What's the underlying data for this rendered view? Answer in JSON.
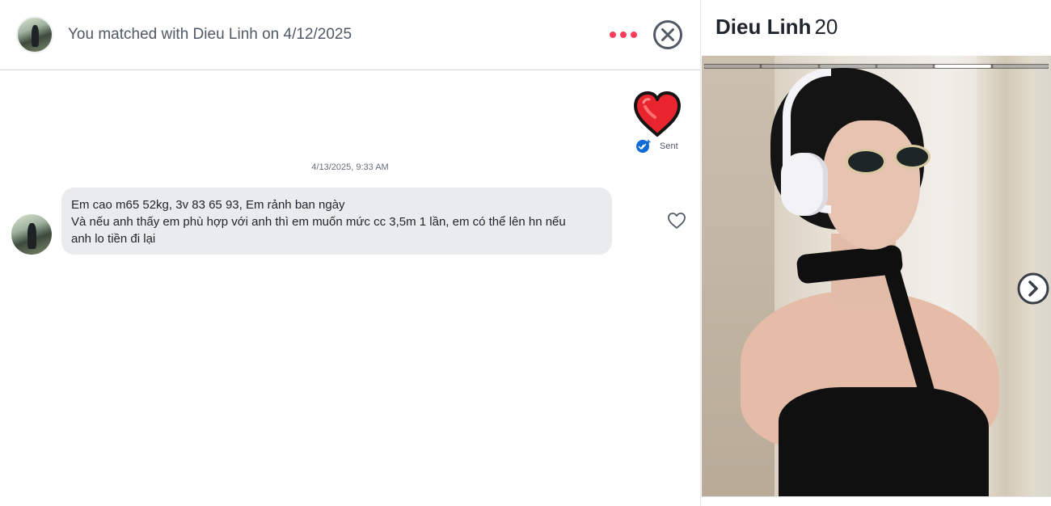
{
  "header": {
    "match_text": "You matched with Dieu Linh on 4/12/2025",
    "more_icon": "more-dots-icon",
    "close_icon": "close-circle-icon"
  },
  "conversation": {
    "sent_reaction": {
      "icon": "heart-icon",
      "status": "Sent"
    },
    "timestamp": "4/13/2025, 9:33 AM",
    "message": {
      "lines": [
        "Em cao m65 52kg, 3v 83 65 93, Em rảnh ban ngày",
        "Và nếu anh thấy em phù hợp với anh thì em muốn mức cc 3,5m 1 lần, em có thể lên hn nếu",
        "anh lo tiền đi lại"
      ]
    }
  },
  "profile": {
    "name": "Dieu Linh",
    "age": "20",
    "photo_count": 6,
    "active_photo": 5
  },
  "colors": {
    "accent": "#fd3d5b",
    "heart": "#e8252f",
    "bubble": "#eaebed",
    "check": "#106bd5"
  }
}
